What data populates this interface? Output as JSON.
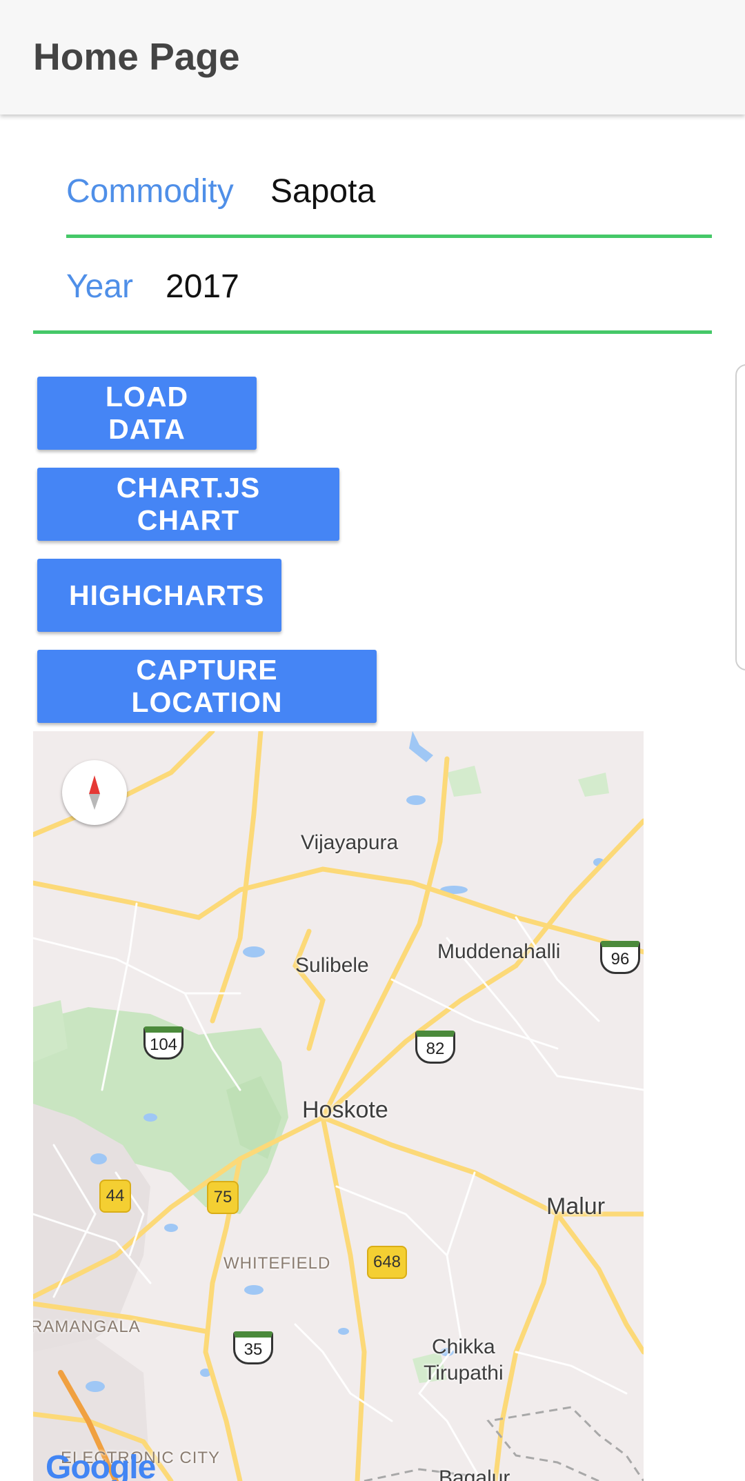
{
  "appbar": {
    "title": "Home Page"
  },
  "form": {
    "commodity": {
      "label": "Commodity",
      "value": "Sapota"
    },
    "year": {
      "label": "Year",
      "value": "2017"
    }
  },
  "buttons": {
    "load_data": "LOAD DATA",
    "chartjs_chart": "CHART.JS CHART",
    "highcharts": "HIGHCHARTS",
    "capture_location": "CAPTURE LOCATION"
  },
  "map": {
    "places": {
      "vijayapura": "Vijayapura",
      "sulibele": "Sulibele",
      "muddenahalli": "Muddenahalli",
      "hoskote": "Hoskote",
      "malur": "Malur",
      "whitefield": "WHITEFIELD",
      "ramangala": "RAMANGALA",
      "chikka_tirupathi_1": "Chikka",
      "chikka_tirupathi_2": "Tirupathi",
      "electronic_city": "ELECTRONIC CITY",
      "bagalur": "Bagalur"
    },
    "shields": {
      "r96": "96",
      "r104": "104",
      "r82": "82",
      "r44": "44",
      "r75": "75",
      "r648": "648",
      "r35": "35"
    },
    "attribution": "Google"
  },
  "colors": {
    "accent": "#4585f5",
    "label": "#4f8fe8",
    "underline": "#45c868",
    "road": "#fcd978",
    "map_bg": "#f1ecec",
    "park": "#c7e6c0",
    "water": "#9fc7f5"
  }
}
